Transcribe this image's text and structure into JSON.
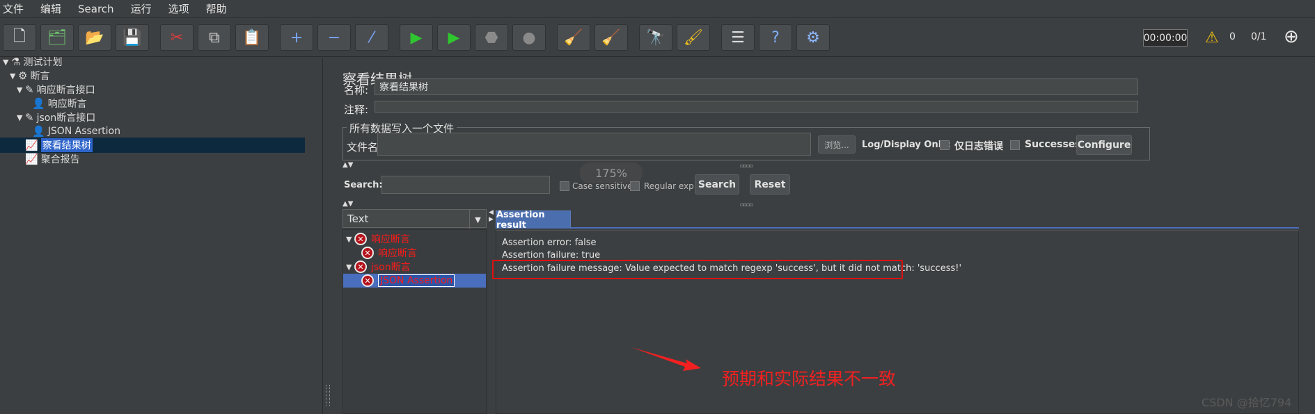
{
  "menu": [
    "文件",
    "编辑",
    "Search",
    "运行",
    "选项",
    "帮助"
  ],
  "toolbar": {
    "buttons": [
      {
        "name": "new-button",
        "glyph": "🗋",
        "color": "#f2f2f2"
      },
      {
        "name": "templates-button",
        "glyph": "🗂",
        "color": "#6dbb6d"
      },
      {
        "name": "open-button",
        "glyph": "📂",
        "color": "#e0b24a"
      },
      {
        "name": "save-button",
        "glyph": "💾",
        "color": "#cfcfcf"
      },
      {
        "name": "cut-button",
        "glyph": "✂",
        "color": "#e23b3b"
      },
      {
        "name": "copy-button",
        "glyph": "⧉",
        "color": "#dddddd"
      },
      {
        "name": "paste-button",
        "glyph": "📋",
        "color": "#d6b25a"
      },
      {
        "name": "expand-button",
        "glyph": "+",
        "color": "#79a6ff"
      },
      {
        "name": "collapse-button",
        "glyph": "−",
        "color": "#79a6ff"
      },
      {
        "name": "toggle-button",
        "glyph": "⁄",
        "color": "#79a6ff"
      },
      {
        "name": "start-button",
        "glyph": "▶",
        "color": "#2fc62f"
      },
      {
        "name": "start-no-pauses-button",
        "glyph": "▶",
        "color": "#2fc62f"
      },
      {
        "name": "stop-button",
        "glyph": "⬣",
        "color": "#8a8a8a"
      },
      {
        "name": "shutdown-button",
        "glyph": "●",
        "color": "#8a8a8a"
      },
      {
        "name": "clear-button",
        "glyph": "🧹",
        "color": "#c9a56a"
      },
      {
        "name": "clear-all-button",
        "glyph": "🧹",
        "color": "#c9a56a"
      },
      {
        "name": "search-button",
        "glyph": "🔭",
        "color": "#dddddd"
      },
      {
        "name": "reset-search-button",
        "glyph": "🖌",
        "color": "#f0c020"
      },
      {
        "name": "function-helper-button",
        "glyph": "☰",
        "color": "#dddddd"
      },
      {
        "name": "help-button",
        "glyph": "?",
        "color": "#7fb0ff"
      },
      {
        "name": "remote-button",
        "glyph": "⚙",
        "color": "#8fb8ff"
      }
    ],
    "timer": "00:00:00",
    "warnings": "0",
    "threads": "0/1"
  },
  "tree": [
    {
      "label": "测试计划",
      "arrow": "▼",
      "icon": "⚗",
      "indent": 0
    },
    {
      "label": "断言",
      "arrow": "▼",
      "icon": "⚙",
      "indent": 1
    },
    {
      "label": "响应断言接口",
      "arrow": "▼",
      "icon": "✎",
      "indent": 2
    },
    {
      "label": "响应断言",
      "arrow": "",
      "icon": "👤",
      "indent": 3
    },
    {
      "label": "json断言接口",
      "arrow": "▼",
      "icon": "✎",
      "indent": 2
    },
    {
      "label": "JSON Assertion",
      "arrow": "",
      "icon": "👤",
      "indent": 3
    },
    {
      "label": "察看结果树",
      "arrow": "",
      "icon": "📈",
      "indent": 2,
      "selected": true
    },
    {
      "label": "聚合报告",
      "arrow": "",
      "icon": "📈",
      "indent": 2
    }
  ],
  "panel": {
    "title": "察看结果树",
    "name_label": "名称:",
    "name_value": "察看结果树",
    "comment_label": "注释:",
    "group_title": "所有数据写入一个文件",
    "filename_label": "文件名",
    "browse_label": "浏览...",
    "log_display_label": "Log/Display Only:",
    "errors_only_label": "仅日志错误",
    "successes_label": "Successes",
    "configure_label": "Configure",
    "zoom": "175%",
    "search_label": "Search:",
    "case_sensitive_label": "Case sensitive",
    "regex_label": "Regular exp.",
    "search_button": "Search",
    "reset_button": "Reset",
    "renderer": "Text"
  },
  "results": [
    {
      "label": "响应断言",
      "arrow": "▼",
      "indent": 0
    },
    {
      "label": "响应断言",
      "arrow": "",
      "indent": 1
    },
    {
      "label": "json断言",
      "arrow": "▼",
      "indent": 0
    },
    {
      "label": "JSON Assertion",
      "arrow": "",
      "indent": 1,
      "selected": true
    }
  ],
  "result_tab": "Assertion result",
  "result_lines": [
    "Assertion error: false",
    "Assertion failure: true",
    "Assertion failure message: Value expected to match regexp 'success', but it did not match: 'success!'"
  ],
  "annotation": "预期和实际结果不一致",
  "watermark": "CSDN @拾忆794",
  "colors": {
    "error_red": "#ff1a1a",
    "selection_blue": "#4a6ebe",
    "annotation_red": "#f22020"
  }
}
